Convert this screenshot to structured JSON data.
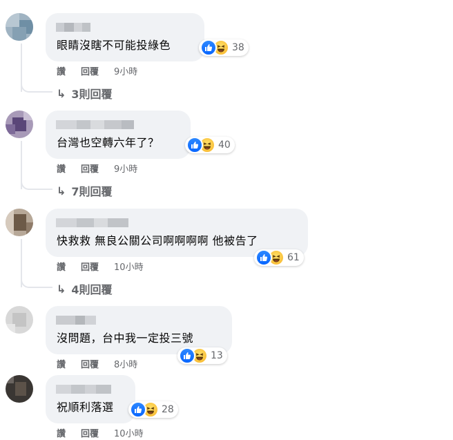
{
  "ui": {
    "like_label": "讚",
    "reply_label": "回覆",
    "icons": [
      "like-icon",
      "haha-icon",
      "reply-arrow-icon"
    ]
  },
  "comments": [
    {
      "text": "眼睛沒瞎不可能投綠色",
      "reactions": "38",
      "time": "9小時",
      "replies": "3則回覆"
    },
    {
      "text": "台灣也空轉六年了？",
      "reactions": "40",
      "time": "9小時",
      "replies": "7則回覆"
    },
    {
      "text": "快救救 無良公關公司啊啊啊啊 他被告了",
      "reactions": "61",
      "time": "10小時",
      "replies": "4則回覆"
    },
    {
      "text": "沒問題，台中我一定投三號",
      "reactions": "13",
      "time": "8小時"
    },
    {
      "text": "祝順利落選",
      "reactions": "28",
      "time": "10小時"
    }
  ]
}
